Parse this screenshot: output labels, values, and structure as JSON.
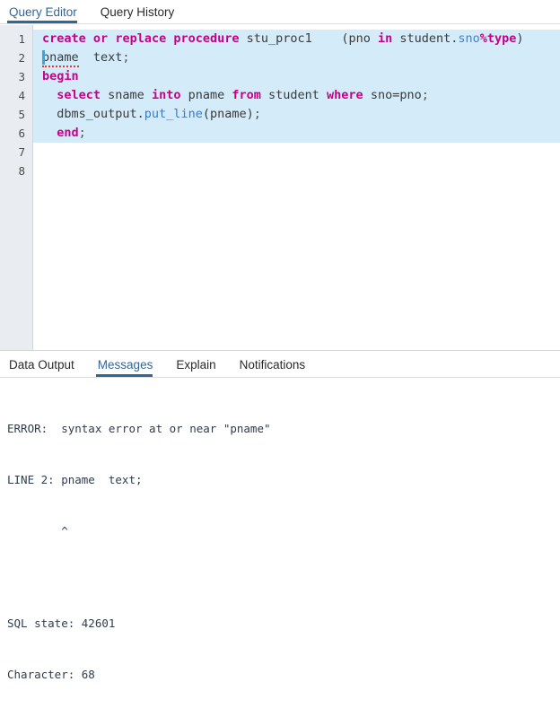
{
  "top_tabs": [
    {
      "label": "Query Editor",
      "active": true
    },
    {
      "label": "Query History",
      "active": false
    }
  ],
  "editor": {
    "line_numbers": [
      "1",
      "2",
      "3",
      "4",
      "5",
      "6",
      "7",
      "8"
    ],
    "selection_color": "#d4ebfa",
    "gutter_color": "#e9edf1",
    "lines": [
      {
        "number": "1",
        "selected": true,
        "text": "create or replace procedure stu_proc1    (pno in student.sno%type)",
        "tokens": [
          {
            "t": "create",
            "c": "kw"
          },
          {
            "t": " ",
            "c": "id"
          },
          {
            "t": "or",
            "c": "kw"
          },
          {
            "t": " ",
            "c": "id"
          },
          {
            "t": "replace",
            "c": "kw"
          },
          {
            "t": " ",
            "c": "id"
          },
          {
            "t": "procedure",
            "c": "kw"
          },
          {
            "t": " stu_proc1    (pno ",
            "c": "id"
          },
          {
            "t": "in",
            "c": "kw"
          },
          {
            "t": " student.",
            "c": "id"
          },
          {
            "t": "sno",
            "c": "attr"
          },
          {
            "t": "%type",
            "c": "kw"
          },
          {
            "t": ")",
            "c": "id"
          }
        ]
      },
      {
        "number": "2",
        "selected": true,
        "has_caret": true,
        "text": "pname  text;",
        "tokens": [
          {
            "t": "pname",
            "c": "id",
            "squiggle": true
          },
          {
            "t": "  ",
            "c": "id"
          },
          {
            "t": "text",
            "c": "id"
          },
          {
            "t": ";",
            "c": "pn"
          }
        ]
      },
      {
        "number": "3",
        "selected": true,
        "text": "begin",
        "tokens": [
          {
            "t": "begin",
            "c": "kw"
          }
        ]
      },
      {
        "number": "4",
        "selected": true,
        "text": "  select sname into pname from student where sno=pno;",
        "tokens": [
          {
            "t": "  ",
            "c": "id"
          },
          {
            "t": "select",
            "c": "kw"
          },
          {
            "t": " sname ",
            "c": "id"
          },
          {
            "t": "into",
            "c": "kw"
          },
          {
            "t": " pname ",
            "c": "id"
          },
          {
            "t": "from",
            "c": "kw"
          },
          {
            "t": " student ",
            "c": "id"
          },
          {
            "t": "where",
            "c": "kw"
          },
          {
            "t": " sno=pno",
            "c": "id"
          },
          {
            "t": ";",
            "c": "pn"
          }
        ]
      },
      {
        "number": "5",
        "selected": true,
        "text": "  dbms_output.put_line(pname);",
        "tokens": [
          {
            "t": "  dbms_output.",
            "c": "id"
          },
          {
            "t": "put_line",
            "c": "fn"
          },
          {
            "t": "(pname)",
            "c": "id"
          },
          {
            "t": ";",
            "c": "pn"
          }
        ]
      },
      {
        "number": "6",
        "selected": true,
        "text": "  end;",
        "tokens": [
          {
            "t": "  ",
            "c": "id"
          },
          {
            "t": "end",
            "c": "kw"
          },
          {
            "t": ";",
            "c": "pn"
          }
        ]
      },
      {
        "number": "7",
        "selected": false,
        "text": "",
        "tokens": []
      },
      {
        "number": "8",
        "selected": false,
        "text": "",
        "tokens": []
      }
    ]
  },
  "result_tabs": [
    {
      "label": "Data Output",
      "active": false
    },
    {
      "label": "Messages",
      "active": true
    },
    {
      "label": "Explain",
      "active": false
    },
    {
      "label": "Notifications",
      "active": false
    }
  ],
  "messages": {
    "lines": [
      "ERROR:  syntax error at or near \"pname\"",
      "LINE 2: pname  text;",
      "        ^",
      "",
      "SQL state: 42601",
      "Character: 68"
    ],
    "error_text": "ERROR:  syntax error at or near \"pname\"",
    "line_text": "LINE 2: pname  text;",
    "caret_text": "        ^",
    "sql_state": "SQL state: 42601",
    "character": "Character: 68"
  }
}
